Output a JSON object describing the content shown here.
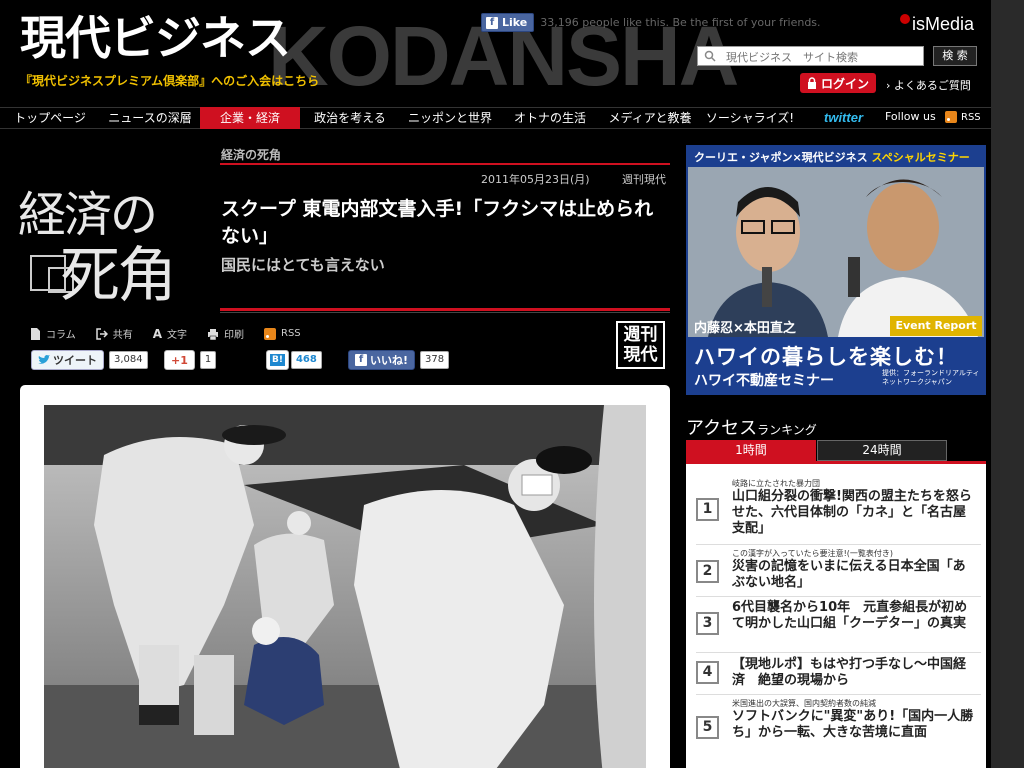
{
  "header": {
    "logo": "現代ビジネス",
    "watermark": "KODANSHA",
    "premium_link": "『現代ビジネスプレミアム倶楽部』へのご入会はこちら",
    "fb_like_label": "Like",
    "fb_like_text": "33,196 people like this. Be the first of your friends.",
    "ismedia_logo": "isMedia",
    "search_placeholder": "現代ビジネス　サイト検索",
    "search_button": "検 索",
    "login_button": "ログイン",
    "faq_link": "› よくあるご質問"
  },
  "nav": {
    "items": [
      {
        "label": "トップページ",
        "active": false
      },
      {
        "label": "ニュースの深層",
        "active": false
      },
      {
        "label": "企業・経済",
        "active": true
      },
      {
        "label": "政治を考える",
        "active": false
      },
      {
        "label": "ニッポンと世界",
        "active": false
      },
      {
        "label": "オトナの生活",
        "active": false
      },
      {
        "label": "メディアと教養",
        "active": false
      },
      {
        "label": "ソーシャライズ!",
        "active": false
      }
    ],
    "twitter": "twitter",
    "follow_us": "Follow us",
    "rss": "RSS"
  },
  "article": {
    "series_logo_line1": "経済の",
    "series_logo_line2": "死角",
    "category": "経済の死角",
    "date": "2011年05月23日(月)",
    "source": "週刊現代",
    "title": "スクープ 東電内部文書入手!「フクシマは止められない」",
    "subtitle": "国民にはとても言えない",
    "tools": [
      "コラム",
      "共有",
      "文字",
      "印刷",
      "RSS"
    ],
    "publication_logo": "週刊現代",
    "social": {
      "tweet_label": "ツイート",
      "tweet_count": "3,084",
      "gplus_label": "+1",
      "gplus_count": "1",
      "hatena_label": "B!",
      "hatena_count": "468",
      "fb_label": "いいね!",
      "fb_count": "378"
    }
  },
  "sidebar": {
    "ad": {
      "top": "クーリエ・ジャポン×現代ビジネス",
      "top_highlight": "スペシャルセミナー",
      "names": "内藤忍×本田直之",
      "event": "Event Report",
      "main": "ハワイの暮らしを楽しむ！",
      "sub": "ハワイ不動産セミナー",
      "sponsor": "提供：フォーランドリアルティ\nネットワークジャパン"
    },
    "ranking": {
      "title": "アクセス",
      "title_small": "ランキング",
      "tabs": [
        "1時間",
        "24時間"
      ],
      "items": [
        {
          "num": "1",
          "teaser": "岐路に立たされた暴力団",
          "title": "山口組分裂の衝撃!関西の盟主たちを怒らせた、六代目体制の「カネ」と「名古屋支配」"
        },
        {
          "num": "2",
          "teaser": "この漢字が入っていたら要注意!(一覧表付き)",
          "title": "災害の記憶をいまに伝える日本全国「あぶない地名」"
        },
        {
          "num": "3",
          "teaser": "",
          "title": "6代目襲名から10年　元直参組長が初めて明かした山口組「クーデター」の真実"
        },
        {
          "num": "4",
          "teaser": "",
          "title": "【現地ルポ】もはや打つ手なし〜中国経済　絶望の現場から"
        },
        {
          "num": "5",
          "teaser": "米国進出の大誤算、国内契約者数の純減",
          "title": "ソフトバンクに\"異変\"あり!「国内一人勝ち」から一転、大きな苦境に直面"
        }
      ]
    }
  },
  "colors": {
    "accent_red": "#cf1020",
    "premium_yellow": "#f0c000",
    "ad_blue": "#1c3f8f"
  }
}
